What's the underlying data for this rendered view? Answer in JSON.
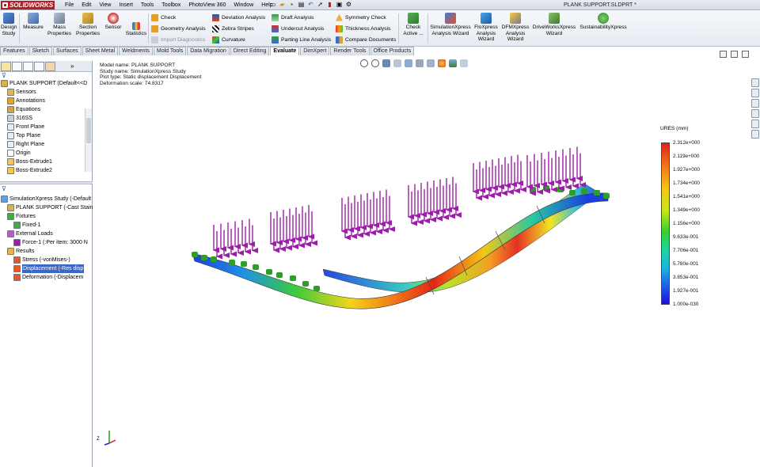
{
  "app": {
    "brand": "SOLIDWORKS",
    "document_title": "PLANK SUPPORT.SLDPRT *"
  },
  "menu": [
    "File",
    "Edit",
    "View",
    "Insert",
    "Tools",
    "Toolbox",
    "PhotoView 360",
    "Window",
    "Help"
  ],
  "ribbon": {
    "big_buttons": [
      {
        "label": "Design Study",
        "icon": "design-study-icon"
      },
      {
        "label": "Measure",
        "icon": "measure-icon"
      },
      {
        "label": "Mass Properties",
        "icon": "mass-properties-icon"
      },
      {
        "label": "Section Properties",
        "icon": "section-properties-icon"
      },
      {
        "label": "Sensor",
        "icon": "sensor-icon"
      },
      {
        "label": "Statistics",
        "icon": "statistics-icon"
      }
    ],
    "col1": [
      {
        "label": "Check",
        "disabled": false
      },
      {
        "label": "Geometry Analysis",
        "disabled": false
      },
      {
        "label": "Import Diagnostics",
        "disabled": true
      }
    ],
    "col2": [
      "Deviation Analysis",
      "Zebra Stripes",
      "Curvature"
    ],
    "col3": [
      "Draft Analysis",
      "Undercut Analysis",
      "Parting Line Analysis"
    ],
    "col4": [
      "Symmetry Check",
      "Thickness Analysis",
      "Compare Documents"
    ],
    "check_active": "Check Active ...",
    "xpress": [
      "SimulationXpress Analysis Wizard",
      "FloXpress Analysis Wizard",
      "DFMXpress Analysis Wizard",
      "DriveWorksXpress Wizard",
      "SustainabilityXpress"
    ]
  },
  "tabs": [
    {
      "label": "Features",
      "active": false
    },
    {
      "label": "Sketch",
      "active": false
    },
    {
      "label": "Surfaces",
      "active": false
    },
    {
      "label": "Sheet Metal",
      "active": false
    },
    {
      "label": "Weldments",
      "active": false
    },
    {
      "label": "Mold Tools",
      "active": false
    },
    {
      "label": "Data Migration",
      "active": false
    },
    {
      "label": "Direct Editing",
      "active": false
    },
    {
      "label": "Evaluate",
      "active": true
    },
    {
      "label": "DimXpert",
      "active": false
    },
    {
      "label": "Render Tools",
      "active": false
    },
    {
      "label": "Office Products",
      "active": false
    }
  ],
  "feature_tree": [
    {
      "label": "PLANK SUPPORT  (Default<<D",
      "icon": "part-icon",
      "indent": 0
    },
    {
      "label": "Sensors",
      "icon": "sensors-icon",
      "indent": 1
    },
    {
      "label": "Annotations",
      "icon": "annotations-icon",
      "indent": 1
    },
    {
      "label": "Equations",
      "icon": "equations-icon",
      "indent": 1
    },
    {
      "label": "316SS",
      "icon": "material-icon",
      "indent": 1
    },
    {
      "label": "Front Plane",
      "icon": "plane-icon",
      "indent": 1
    },
    {
      "label": "Top Plane",
      "icon": "plane-icon",
      "indent": 1
    },
    {
      "label": "Right Plane",
      "icon": "plane-icon",
      "indent": 1
    },
    {
      "label": "Origin",
      "icon": "origin-icon",
      "indent": 1
    },
    {
      "label": "Boss-Extrude1",
      "icon": "extrude-icon",
      "indent": 1
    },
    {
      "label": "Boss-Extrude2",
      "icon": "extrude-icon",
      "indent": 1
    }
  ],
  "sim_tree": [
    {
      "label": "SimulationXpress Study (-Default",
      "icon": "study-icon",
      "indent": 0,
      "selected": false
    },
    {
      "label": "PLANK SUPPORT (-Cast Stainl",
      "icon": "part-icon",
      "indent": 1,
      "selected": false
    },
    {
      "label": "Fixtures",
      "icon": "fixtures-icon",
      "indent": 1,
      "selected": false
    },
    {
      "label": "Fixed-1",
      "icon": "fixed-icon",
      "indent": 2,
      "selected": false
    },
    {
      "label": "External Loads",
      "icon": "loads-icon",
      "indent": 1,
      "selected": false
    },
    {
      "label": "Force-1 (:Per item: 3000 N",
      "icon": "force-icon",
      "indent": 2,
      "selected": false
    },
    {
      "label": "Results",
      "icon": "results-icon",
      "indent": 1,
      "selected": false
    },
    {
      "label": "Stress (-vonMises-)",
      "icon": "plot-icon",
      "indent": 2,
      "selected": false
    },
    {
      "label": "Displacement (-Res disp",
      "icon": "plot-icon",
      "indent": 2,
      "selected": true
    },
    {
      "label": "Deformation (-Displacem",
      "icon": "plot-icon",
      "indent": 2,
      "selected": false
    }
  ],
  "plot_info": [
    "Model name: PLANK SUPPORT",
    "Study name: SimulationXpress Study",
    "Plot type: Static displacement Displacement",
    "Deformation scale: 74.8317"
  ],
  "legend": {
    "title": "URES (mm)",
    "labels": [
      "2.312e+000",
      "2.119e+000",
      "1.927e+000",
      "1.734e+000",
      "1.541e+000",
      "1.349e+000",
      "1.156e+000",
      "9.633e-001",
      "7.706e-001",
      "5.780e-001",
      "3.853e-001",
      "1.927e-001",
      "1.000e-030"
    ]
  },
  "colors": {
    "accent": "#b21f24",
    "load_arrow": "#9b1ea6",
    "fixture": "#2e9e2b",
    "selection": "#3a67c9"
  }
}
